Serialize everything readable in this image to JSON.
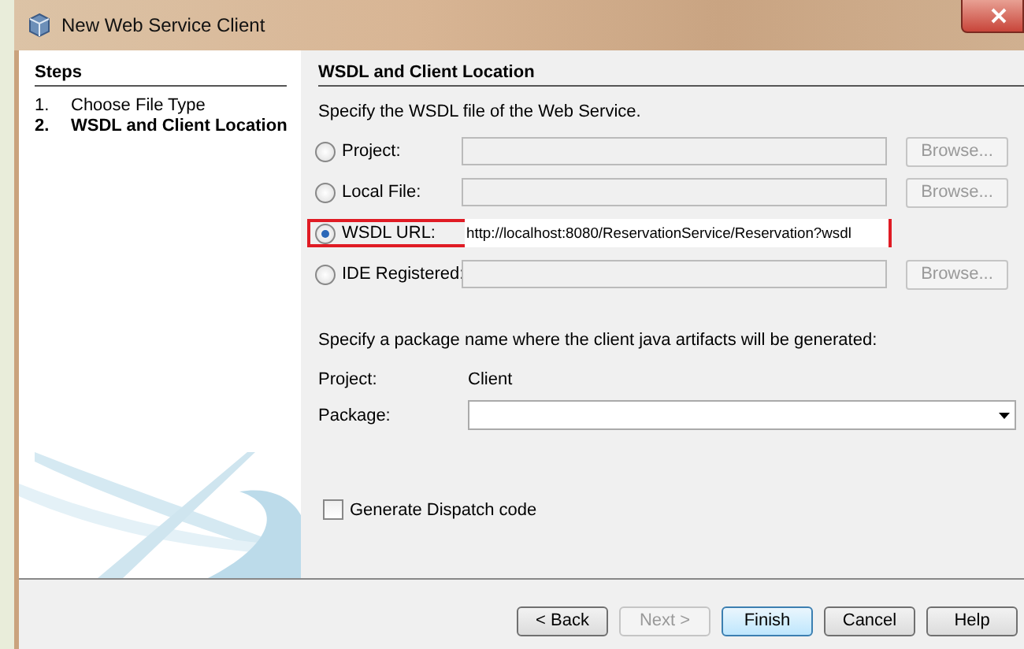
{
  "window": {
    "title": "New Web Service Client"
  },
  "steps": {
    "title": "Steps",
    "items": [
      {
        "number": "1.",
        "label": "Choose File Type",
        "selected": false
      },
      {
        "number": "2.",
        "label": "WSDL and Client Location",
        "selected": true
      }
    ]
  },
  "panel": {
    "title": "WSDL and Client Location",
    "instruction": "Specify the WSDL file of the Web Service.",
    "sources": [
      {
        "label": "Project:",
        "selected": false,
        "highlighted": false,
        "browse": "Browse..."
      },
      {
        "label": "Local File:",
        "selected": false,
        "highlighted": false,
        "browse": "Browse..."
      },
      {
        "label": "WSDL URL:",
        "selected": true,
        "highlighted": true,
        "value": "http://localhost:8080/ReservationService/Reservation?wsdl"
      },
      {
        "label": "IDE Registered:",
        "selected": false,
        "highlighted": false,
        "browse": "Browse..."
      }
    ],
    "package_instruction": "Specify a package name where the client java artifacts will be generated:",
    "project": {
      "label": "Project:",
      "value": "Client"
    },
    "package": {
      "label": "Package:"
    },
    "dispatch": {
      "label": "Generate Dispatch code",
      "checked": false
    }
  },
  "buttons": [
    {
      "label": "< Back",
      "disabled": false,
      "default": false
    },
    {
      "label": "Next >",
      "disabled": true,
      "default": false
    },
    {
      "label": "Finish",
      "disabled": false,
      "default": true
    },
    {
      "label": "Cancel",
      "disabled": false,
      "default": false
    },
    {
      "label": "Help",
      "disabled": false,
      "default": false
    }
  ]
}
